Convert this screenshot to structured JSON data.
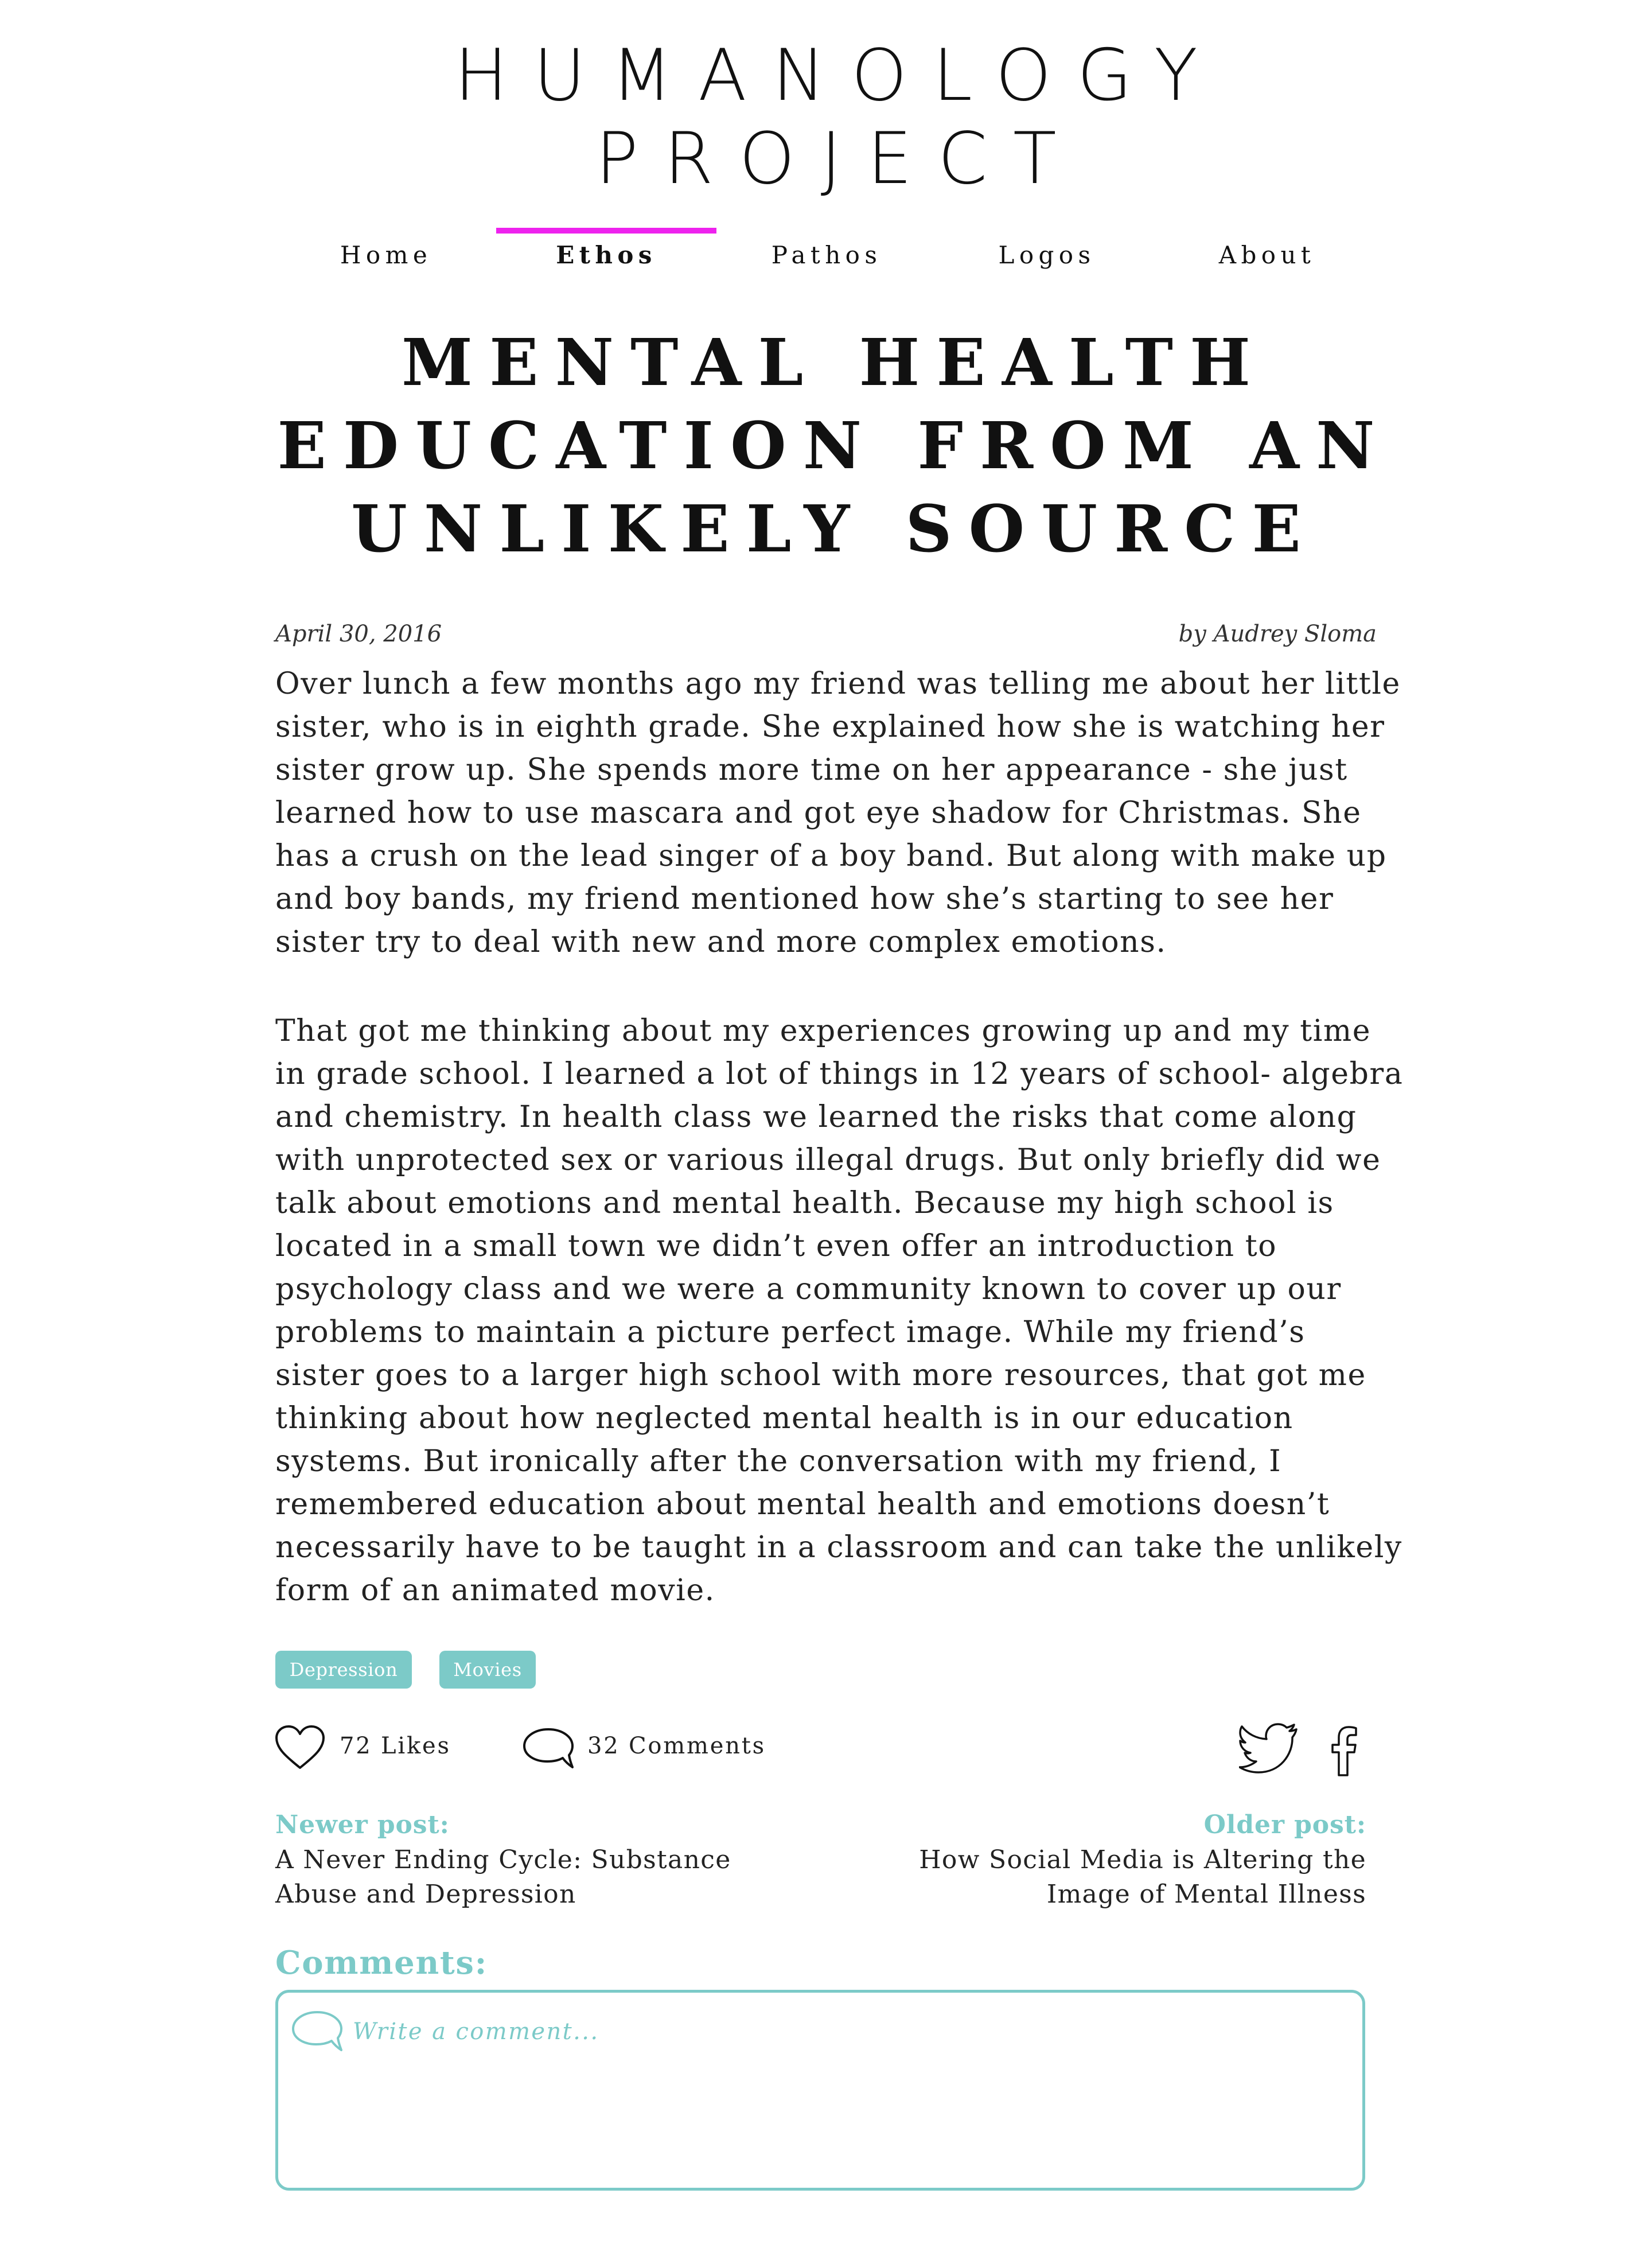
{
  "site": {
    "title_line1": "HUMANOLOGY",
    "title_line2": "PROJECT"
  },
  "nav": {
    "items": [
      "Home",
      "Ethos",
      "Pathos",
      "Logos",
      "About"
    ],
    "active": "Ethos",
    "accent_color": "#ee22ee"
  },
  "article": {
    "title_lines": [
      "MENTAL HEALTH",
      "EDUCATION FROM AN",
      "UNLIKELY SOURCE"
    ],
    "date": "April 30, 2016",
    "author": "by Audrey Sloma",
    "paragraph1_lines": [
      "Over lunch a few months ago my friend was telling me about her little",
      "sister, who is in eighth grade.  She explained how she is watching her",
      "sister grow up.  She spends more time on her appearance - she just",
      "learned how to use mascara and got eye shadow for Christmas.  She",
      "has a crush on the lead singer of a boy band.  But along with make up",
      "and boy bands, my friend mentioned how she’s starting to see her",
      "sister try to deal with new and more complex emotions."
    ],
    "paragraph2_lines": [
      "That got me thinking about my experiences growing up and my time",
      "in grade school.  I learned a lot of things in 12 years of school- algebra",
      "and chemistry.  In health class we learned the risks that come along",
      "with unprotected sex or various illegal drugs.  But only briefly did we",
      "talk about emotions and mental health.  Because my high school is",
      "located in a small town we didn’t even offer an introduction to",
      "psychology class and we were a community known to cover up our",
      "problems to maintain a picture perfect image.  While my friend’s",
      "sister goes to a larger high school with more resources, that got me",
      "thinking about how neglected mental health is in our education",
      "systems.  But ironically after the conversation with my friend, I",
      "remembered education about mental health and emotions doesn’t",
      "necessarily have to be taught in a classroom and can take the unlikely",
      "form of an animated movie."
    ]
  },
  "tags": [
    "Depression",
    "Movies"
  ],
  "tag_color": "#7ccac8",
  "engagement": {
    "likes": "72 Likes",
    "comments": "32 Comments",
    "like_icon": "heart-icon",
    "comment_icon": "speech-bubble-icon",
    "share_icons": [
      "twitter-icon",
      "facebook-icon"
    ]
  },
  "post_nav": {
    "newer_label": "Newer post:",
    "newer_title_lines": [
      "A Never Ending Cycle: Substance",
      "Abuse and Depression"
    ],
    "older_label": "Older post:",
    "older_title_lines": [
      "How Social Media is Altering the",
      "Image of Mental Illness"
    ]
  },
  "comments": {
    "heading": "Comments:",
    "placeholder": "Write a comment..."
  }
}
